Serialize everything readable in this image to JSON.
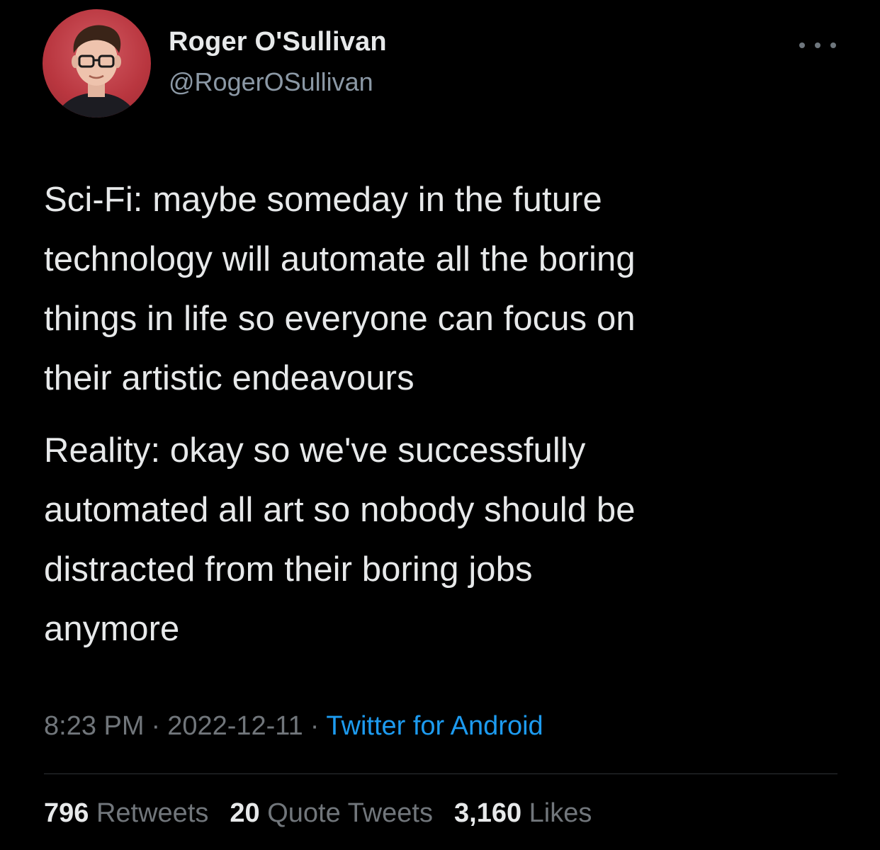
{
  "author": {
    "display_name": "Roger O'Sullivan",
    "handle": "@RogerOSullivan",
    "avatar_icon": "user-avatar-photo",
    "avatar_bg_color": "#b9363f"
  },
  "menu": {
    "more_icon": "more-horizontal-icon"
  },
  "tweet": {
    "paragraphs": [
      "Sci-Fi: maybe someday in the future\ntechnology will automate all the boring\nthings in life so everyone can focus on\ntheir artistic endeavours",
      "Reality: okay so we've successfully\nautomated all art so nobody should be\ndistracted from their boring jobs\nanymore"
    ],
    "time": "8:23 PM",
    "date": "2022-12-11",
    "separator": "·",
    "source": "Twitter for Android"
  },
  "stats": {
    "retweets_count": "796",
    "retweets_label": "Retweets",
    "quotes_count": "20",
    "quotes_label": "Quote Tweets",
    "likes_count": "3,160",
    "likes_label": "Likes"
  },
  "colors": {
    "background": "#000000",
    "text_primary": "#e7e9ea",
    "text_secondary": "#71767b",
    "link": "#1d9bf0",
    "divider": "#2f3336"
  }
}
